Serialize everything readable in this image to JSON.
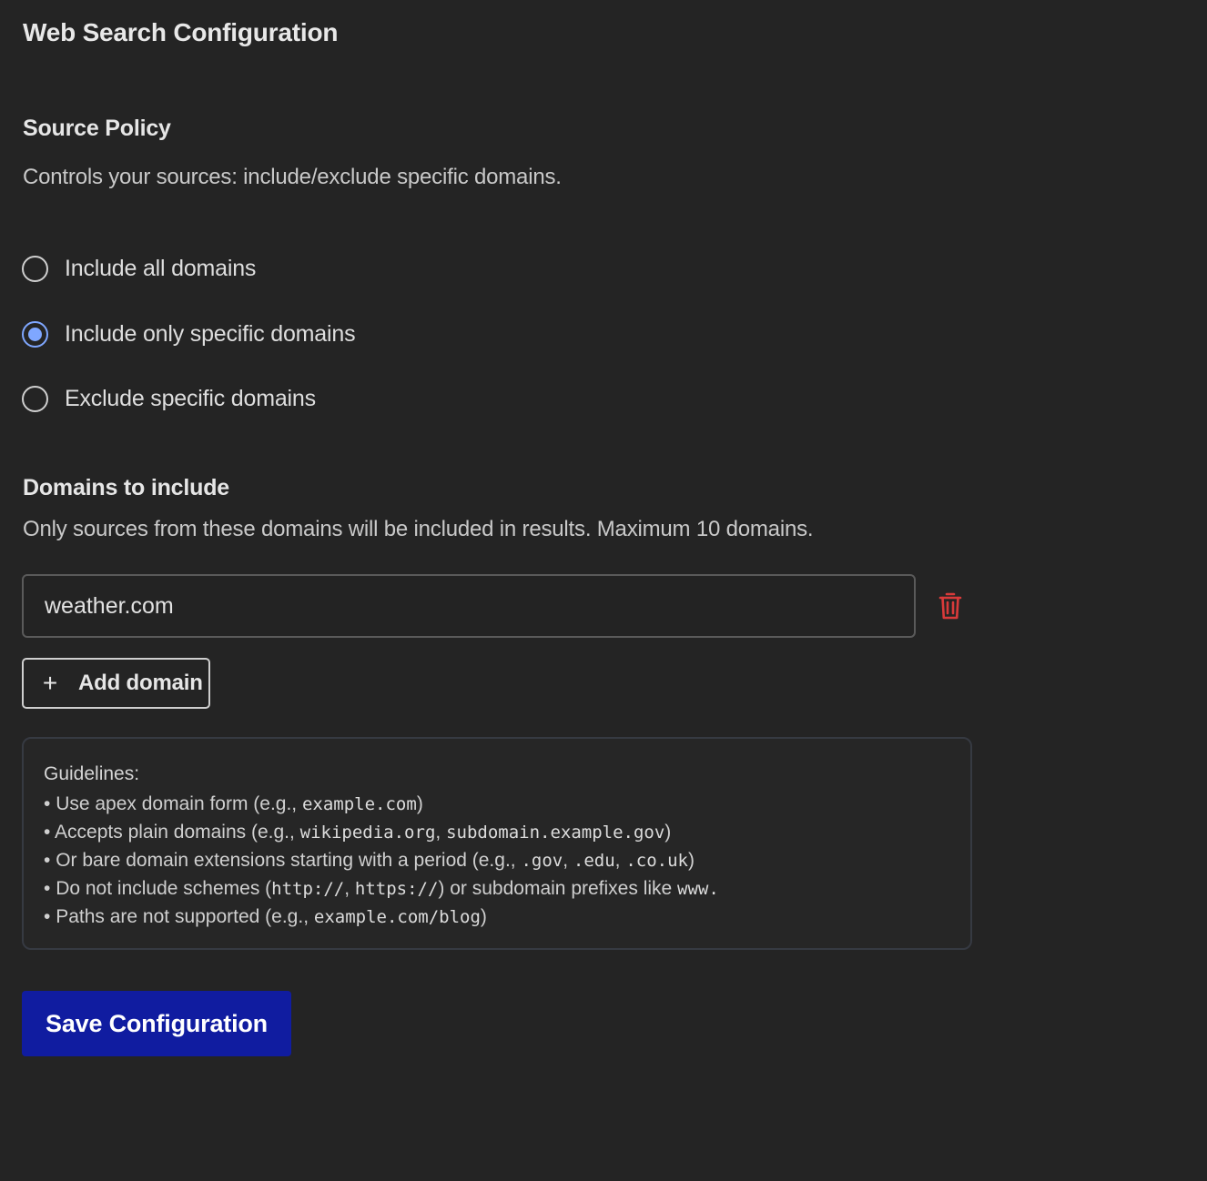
{
  "page": {
    "title": "Web Search Configuration"
  },
  "source_policy": {
    "title": "Source Policy",
    "description": "Controls your sources: include/exclude specific domains.",
    "options": [
      {
        "label": "Include all domains",
        "checked": false
      },
      {
        "label": "Include only specific domains",
        "checked": true
      },
      {
        "label": "Exclude specific domains",
        "checked": false
      }
    ]
  },
  "domains": {
    "title": "Domains to include",
    "description": "Only sources from these domains will be included in results. Maximum 10 domains.",
    "entries": [
      "weather.com"
    ],
    "delete_icon": "trash-icon",
    "delete_icon_color": "#d93a3a",
    "add_label": "Add domain",
    "add_icon": "plus-icon"
  },
  "guidelines": {
    "title": "Guidelines:",
    "bullet": "•",
    "items": [
      {
        "a": " Use apex domain form (e.g., ",
        "c1": "example.com",
        "b": ")"
      },
      {
        "a": " Accepts plain domains (e.g., ",
        "c1": "wikipedia.org",
        "b": ", ",
        "c2": "subdomain.example.gov",
        "d": ")"
      },
      {
        "a": " Or bare domain extensions starting with a period (e.g., ",
        "c1": ".gov",
        "b": ", ",
        "c2": ".edu",
        "d": ", ",
        "c3": ".co.uk",
        "e": ")"
      },
      {
        "a": " Do not include schemes (",
        "c1": "http://",
        "b": ", ",
        "c2": "https://",
        "d": ") or subdomain prefixes like ",
        "c3": "www."
      },
      {
        "a": " Paths are not supported (e.g., ",
        "c1": "example.com/blog",
        "b": ")"
      }
    ]
  },
  "save": {
    "label": "Save Configuration",
    "color": "#101ca0"
  }
}
